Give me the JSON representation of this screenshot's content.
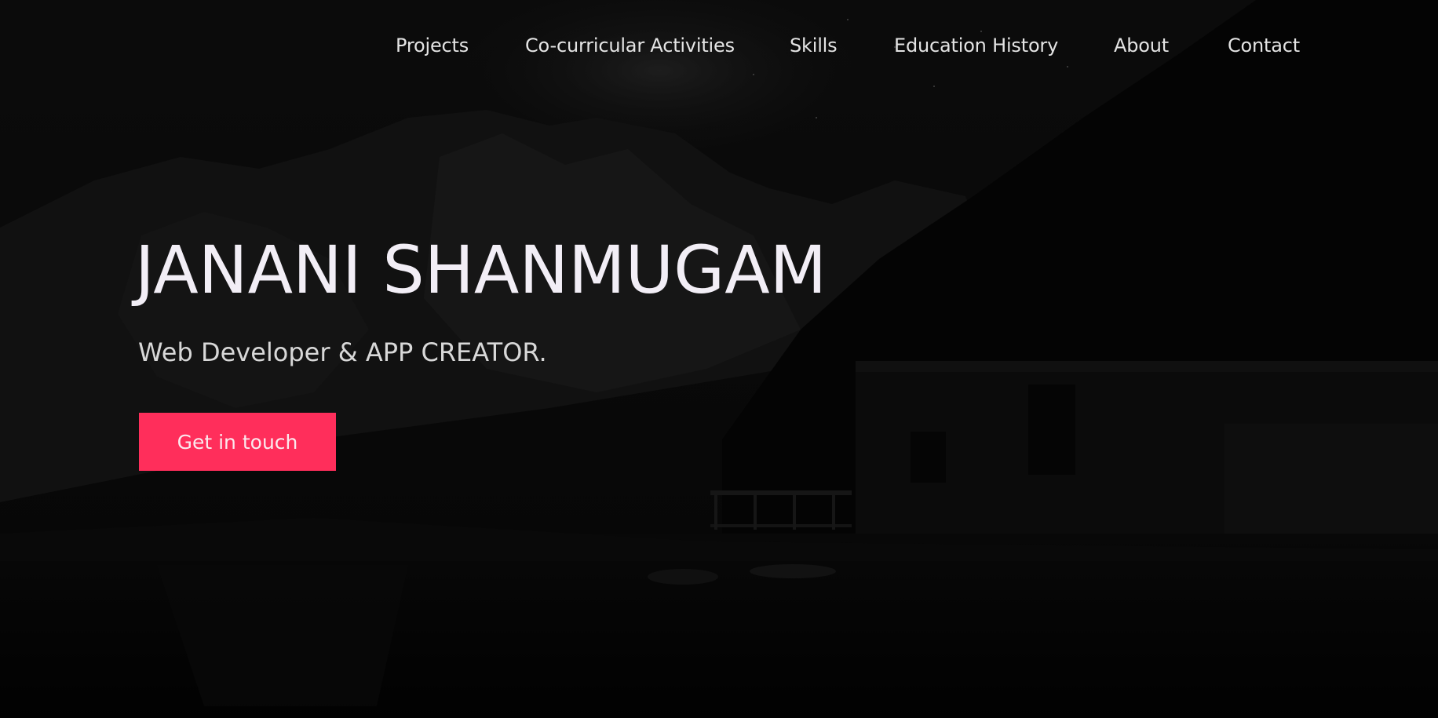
{
  "nav": {
    "items": [
      {
        "label": "Projects"
      },
      {
        "label": "Co-curricular Activities"
      },
      {
        "label": "Skills"
      },
      {
        "label": "Education History"
      },
      {
        "label": "About"
      },
      {
        "label": "Contact"
      }
    ]
  },
  "hero": {
    "name": "JANANI SHANMUGAM",
    "tagline": "Web Developer & APP CREATOR.",
    "cta_label": "Get in touch"
  },
  "colors": {
    "accent": "#ff2e5b",
    "background": "#060606",
    "text": "#f2eef6"
  },
  "background": {
    "icon": "mountain-lake-boathouse-night-photo"
  }
}
